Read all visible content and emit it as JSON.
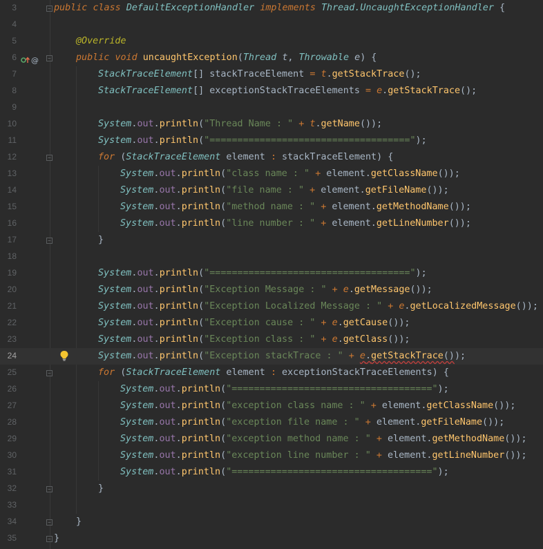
{
  "editor": {
    "colors": {
      "background": "#2b2b2b",
      "current_line": "#323232",
      "keyword": "#cc7832",
      "class": "#80c0c0",
      "string": "#6a8759",
      "function": "#ffc66d",
      "field": "#9876aa",
      "annotation": "#bbb529",
      "text": "#a9b7c6"
    },
    "current_line": "24",
    "gutter_icons": [
      "override-marker-icon",
      "at-sign-icon"
    ],
    "bulb_icon": "lightbulb-icon",
    "lines": [
      {
        "n": "3"
      },
      {
        "n": "4"
      },
      {
        "n": "5"
      },
      {
        "n": "6"
      },
      {
        "n": "7"
      },
      {
        "n": "8"
      },
      {
        "n": "9"
      },
      {
        "n": "10"
      },
      {
        "n": "11"
      },
      {
        "n": "12"
      },
      {
        "n": "13"
      },
      {
        "n": "14"
      },
      {
        "n": "15"
      },
      {
        "n": "16"
      },
      {
        "n": "17"
      },
      {
        "n": "18"
      },
      {
        "n": "19"
      },
      {
        "n": "20"
      },
      {
        "n": "21"
      },
      {
        "n": "22"
      },
      {
        "n": "23"
      },
      {
        "n": "24"
      },
      {
        "n": "25"
      },
      {
        "n": "26"
      },
      {
        "n": "27"
      },
      {
        "n": "28"
      },
      {
        "n": "29"
      },
      {
        "n": "30"
      },
      {
        "n": "31"
      },
      {
        "n": "32"
      },
      {
        "n": "33"
      },
      {
        "n": "34"
      },
      {
        "n": "35"
      }
    ],
    "tokens": {
      "l3": [
        "public",
        " ",
        "class",
        " ",
        "DefaultExceptionHandler",
        " ",
        "implements",
        " ",
        "Thread.UncaughtExceptionHandler",
        " {"
      ],
      "l5": [
        "@Override"
      ],
      "l6": [
        "public",
        " ",
        "void",
        " ",
        "uncaughtException",
        "(",
        "Thread",
        " ",
        "t",
        ", ",
        "Throwable",
        " ",
        "e",
        ") {"
      ],
      "l7": [
        "StackTraceElement",
        "[] stackTraceElement ",
        "=",
        " ",
        "t",
        ".",
        "getStackTrace",
        "();"
      ],
      "l8": [
        "StackTraceElement",
        "[] exceptionStackTraceElements ",
        "=",
        " ",
        "e",
        ".",
        "getStackTrace",
        "();"
      ],
      "l10": [
        "System",
        ".",
        "out",
        ".",
        "println",
        "(",
        "\"Thread Name : \"",
        " ",
        "+",
        " ",
        "t",
        ".",
        "getName",
        "());"
      ],
      "l11": [
        "System",
        ".",
        "out",
        ".",
        "println",
        "(",
        "\"====================================\"",
        ");"
      ],
      "l12": [
        "for",
        " (",
        "StackTraceElement",
        " element ",
        ":",
        " stackTraceElement) {"
      ],
      "l13": [
        "System",
        ".",
        "out",
        ".",
        "println",
        "(",
        "\"class name : \"",
        " ",
        "+",
        " element.",
        "getClassName",
        "());"
      ],
      "l14": [
        "System",
        ".",
        "out",
        ".",
        "println",
        "(",
        "\"file name : \"",
        " ",
        "+",
        " element.",
        "getFileName",
        "());"
      ],
      "l15": [
        "System",
        ".",
        "out",
        ".",
        "println",
        "(",
        "\"method name : \"",
        " ",
        "+",
        " element.",
        "getMethodName",
        "());"
      ],
      "l16": [
        "System",
        ".",
        "out",
        ".",
        "println",
        "(",
        "\"line number : \"",
        " ",
        "+",
        " element.",
        "getLineNumber",
        "());"
      ],
      "l17": [
        "}"
      ],
      "l19": [
        "System",
        ".",
        "out",
        ".",
        "println",
        "(",
        "\"====================================\"",
        ");"
      ],
      "l20": [
        "System",
        ".",
        "out",
        ".",
        "println",
        "(",
        "\"Exception Message : \"",
        " ",
        "+",
        " ",
        "e",
        ".",
        "getMessage",
        "());"
      ],
      "l21": [
        "System",
        ".",
        "out",
        ".",
        "println",
        "(",
        "\"Exception Localized Message : \"",
        " ",
        "+",
        " ",
        "e",
        ".",
        "getLocalizedMessage",
        "());"
      ],
      "l22": [
        "System",
        ".",
        "out",
        ".",
        "println",
        "(",
        "\"Exception cause : \"",
        " ",
        "+",
        " ",
        "e",
        ".",
        "getCause",
        "());"
      ],
      "l23": [
        "System",
        ".",
        "out",
        ".",
        "println",
        "(",
        "\"Exception class : \"",
        " ",
        "+",
        " ",
        "e",
        ".",
        "getClass",
        "());"
      ],
      "l24": [
        "System",
        ".",
        "out",
        ".",
        "println",
        "(",
        "\"Exception stackTrace : \"",
        " ",
        "+",
        " ",
        "e",
        ".",
        "getStackTrace",
        "()",
        ");"
      ],
      "l25": [
        "for",
        " (",
        "StackTraceElement",
        " element ",
        ":",
        " exceptionStackTraceElements) {"
      ],
      "l26": [
        "System",
        ".",
        "out",
        ".",
        "println",
        "(",
        "\"====================================\"",
        ");"
      ],
      "l27": [
        "System",
        ".",
        "out",
        ".",
        "println",
        "(",
        "\"exception class name : \"",
        " ",
        "+",
        " element.",
        "getClassName",
        "());"
      ],
      "l28": [
        "System",
        ".",
        "out",
        ".",
        "println",
        "(",
        "\"exception file name : \"",
        " ",
        "+",
        " element.",
        "getFileName",
        "());"
      ],
      "l29": [
        "System",
        ".",
        "out",
        ".",
        "println",
        "(",
        "\"exception method name : \"",
        " ",
        "+",
        " element.",
        "getMethodName",
        "());"
      ],
      "l30": [
        "System",
        ".",
        "out",
        ".",
        "println",
        "(",
        "\"exception line number : \"",
        " ",
        "+",
        " element.",
        "getLineNumber",
        "());"
      ],
      "l31": [
        "System",
        ".",
        "out",
        ".",
        "println",
        "(",
        "\"====================================\"",
        ");"
      ],
      "l32": [
        "}"
      ],
      "l34": [
        "}"
      ],
      "l35": [
        "}"
      ]
    }
  }
}
